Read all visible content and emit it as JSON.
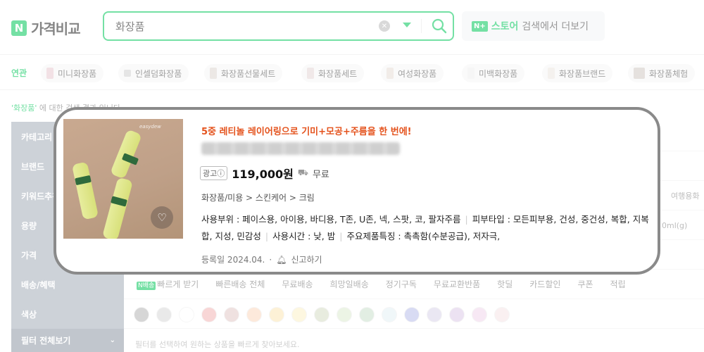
{
  "header": {
    "logo_badge": "N",
    "logo_text": "가격비교",
    "search_value": "화장품",
    "clear_icon": "x-circle-icon",
    "dropdown_icon": "triangle-down-icon",
    "search_icon": "magnifier-icon",
    "store_badge": "N+",
    "store_label": "스토어",
    "store_rest": "검색에서 더보기",
    "brand_color": "#03c75a"
  },
  "related": {
    "label": "연관",
    "items": [
      "미니화장품",
      "인셀덤화장품",
      "화장품선물세트",
      "화장품세트",
      "여성화장품",
      "미백화장품",
      "화장품브랜드",
      "화장품체험"
    ]
  },
  "result_note": {
    "keyword": "'화장품'",
    "rest": "에 대한 검색 결과 입니다."
  },
  "filters": {
    "labels": [
      "카테고리",
      "브랜드",
      "키워드추천",
      "용량",
      "가격",
      "배송/혜택",
      "색상",
      "필터 전체보기"
    ],
    "delivery_badge": "N배송",
    "delivery_options": [
      "빠르게 받기",
      "빠른배송 전체",
      "무료배송",
      "희망일배송",
      "정기구독",
      "무료교환반품",
      "핫딜",
      "카드할인",
      "쿠폰",
      "적립"
    ],
    "colors": [
      "#b5b5b5",
      "#d8d8d8",
      "#ffffff",
      "#f3b4b4",
      "#e2c8c6",
      "#fbd7be",
      "#fbe6b5",
      "#fbf1c6",
      "#d6dcc5",
      "#dcecd0",
      "#cbe1cd",
      "#e3f0f5",
      "#b8bde9",
      "#d9d3ea",
      "#dccbe8",
      "#f0d6ec",
      "#f6e4e6"
    ],
    "hint": "필터를 선택하여 원하는 상품을 빠르게 찾아보세요.",
    "right_fragments": [
      "여행용화",
      "0ml(g)"
    ]
  },
  "product": {
    "title": "5중 레티놀 레이어링으로 기미+모공+주름을 한 번에!",
    "ad_label": "광고ⓘ",
    "price": "119,000원",
    "truck_icon": "truck-icon",
    "shipping": "무료",
    "category": "화장품/미용 > 스킨케어 > 크림",
    "specs": [
      "사용부위 : 페이스용, 아이용, 바디용, T존, U존, 넥, 스팟, 코, 팔자주름",
      "피부타입 : 모든피부용, 건성, 중건성, 복합, 지복합, 지성, 민감성",
      "사용시간 : 낮, 밤",
      "주요제품특징 : 촉촉함(수분공급), 저자극,"
    ],
    "registered": "등록일 2024.04.",
    "report": "신고하기",
    "image_brand": "easydew",
    "heart_icon": "heart-icon",
    "bell_icon": "bell-icon"
  }
}
